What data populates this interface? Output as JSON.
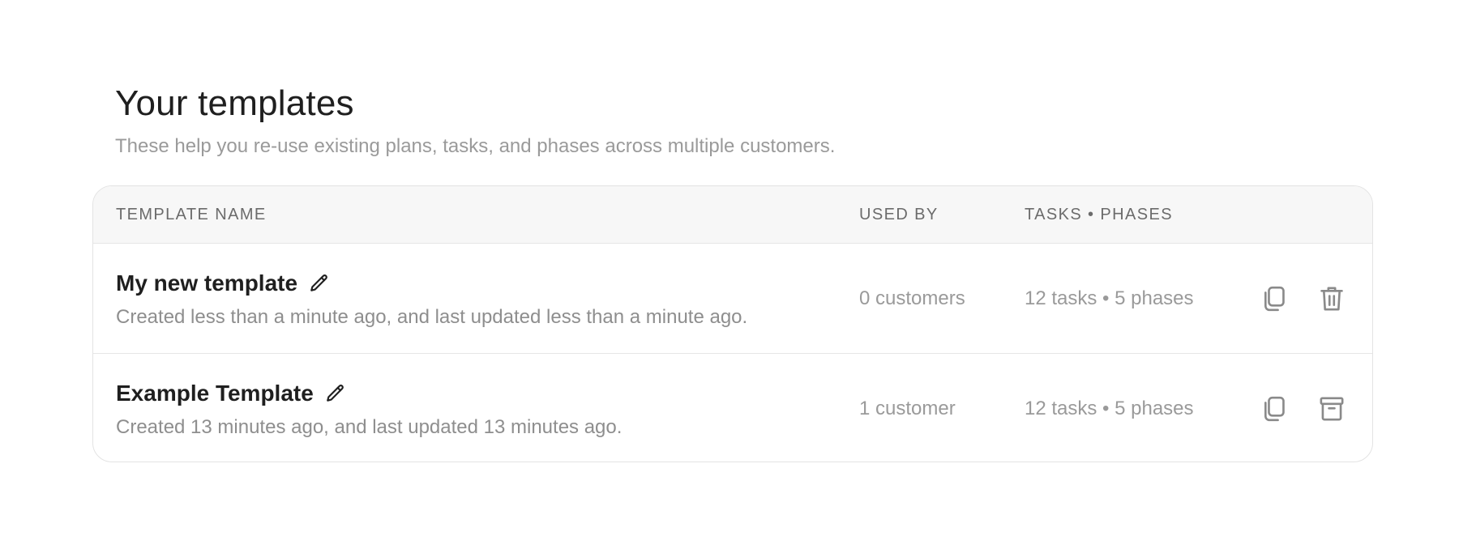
{
  "header": {
    "title": "Your templates",
    "subtitle": "These help you re-use existing plans, tasks, and phases across multiple customers."
  },
  "table": {
    "columns": {
      "name": "Template name",
      "used_by": "Used by",
      "tasks_phases": "Tasks • Phases"
    },
    "rows": [
      {
        "name": "My new template",
        "description": "Created less than a minute ago, and last updated less than a minute ago.",
        "used_by": "0 customers",
        "tasks_phases": "12 tasks • 5 phases",
        "actions": [
          "copy-icon",
          "trash-icon"
        ]
      },
      {
        "name": "Example Template",
        "description": "Created 13 minutes ago, and last updated 13 minutes ago.",
        "used_by": "1 customer",
        "tasks_phases": "12 tasks • 5 phases",
        "actions": [
          "copy-icon",
          "archive-icon"
        ]
      }
    ]
  },
  "colors": {
    "text_primary": "#1f1f1f",
    "text_muted": "#9a9a9a",
    "header_bg": "#f7f7f7",
    "border": "#e3e3e3",
    "icon": "#8a8a8a"
  }
}
